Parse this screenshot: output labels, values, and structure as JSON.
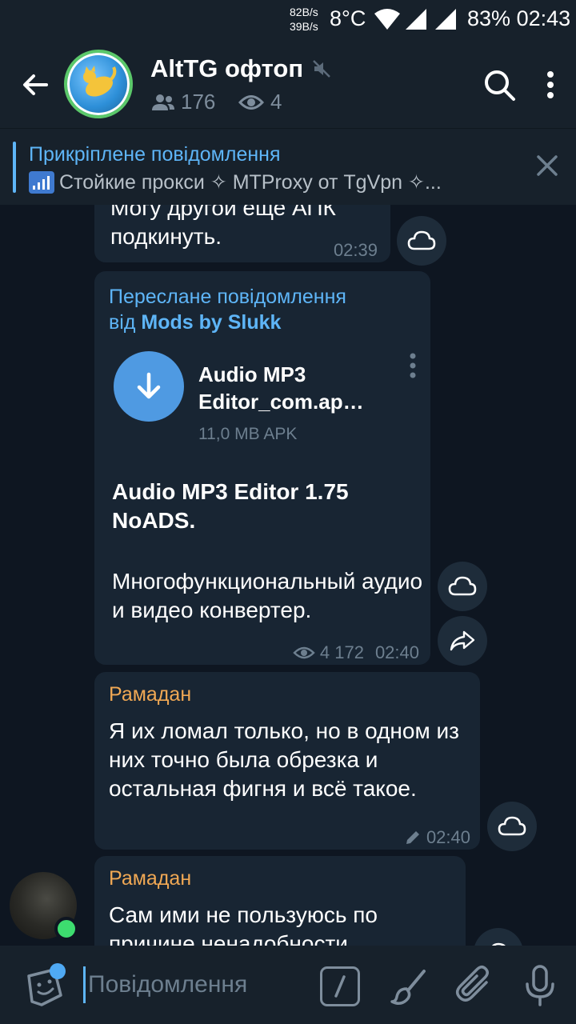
{
  "status_bar": {
    "speed_up": "82B/s",
    "speed_down": "39B/s",
    "temperature": "8°C",
    "battery": "83%",
    "time": "02:43"
  },
  "header": {
    "title": "AltTG офтоп",
    "members": "176",
    "online": "4"
  },
  "pinned": {
    "title": "Прикріплене повідомлення",
    "text": "Стойкие прокси ✧ MTProxy от TgVpn ✧..."
  },
  "messages": [
    {
      "text_line1": "Могу другой еще АПК",
      "text_line2": "подкинуть.",
      "time": "02:39"
    },
    {
      "forwarded_label": "Переслане повідомлення",
      "forwarded_from_prefix": "від",
      "forwarded_from": "Mods by Slukk",
      "file_name": "Audio MP3 Editor_com.ap…",
      "file_size": "11,0 MB APK",
      "body_title": "Audio MP3 Editor 1.75 NoADS.",
      "body_text": "Многофункциональный аудио и видео конвертер.",
      "views": "4 172",
      "time": "02:40"
    },
    {
      "sender": "Рамадан",
      "text": "Я их ломал только, но в одном из них точно была обрезка и остальная фигня и всё такое.",
      "time": "02:40"
    },
    {
      "sender": "Рамадан",
      "text": "Сам ими не пользуюсь по причине ненадобности"
    }
  ],
  "input": {
    "placeholder": "Повідомлення"
  },
  "colors": {
    "accent": "#5eb5f7",
    "sender": "#f0a854",
    "bubble": "#182533",
    "background": "#0e1621",
    "header": "#17212b"
  }
}
